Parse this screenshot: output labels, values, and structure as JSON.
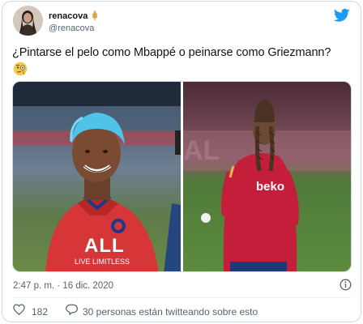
{
  "user": {
    "display_name": "renacova",
    "handle": "@renacova",
    "avatar_icon": "profile-photo",
    "badge_icon": "wheat-emoji"
  },
  "tweet": {
    "text": "¿Pintarse el pelo como Mbappé o peinarse como Griezmann?",
    "trailing_emoji_icon": "monocle-face-emoji",
    "timestamp": "2:47 p. m. · 16 dic. 2020"
  },
  "media": {
    "left_photo": {
      "icon": "photo-player-blue-hair",
      "shirt_sponsor": "ALL",
      "shirt_text": "LIVE LIMITLESS"
    },
    "right_photo": {
      "icon": "photo-player-braids",
      "shirt_sponsor": "beko"
    }
  },
  "actions": {
    "like_count": "182",
    "reply_text": "30 personas están twitteando sobre esto"
  },
  "colors": {
    "brand_blue": "#1d9bf0",
    "text_primary": "#0f1419",
    "text_secondary": "#536471",
    "border": "#cfd9de"
  }
}
